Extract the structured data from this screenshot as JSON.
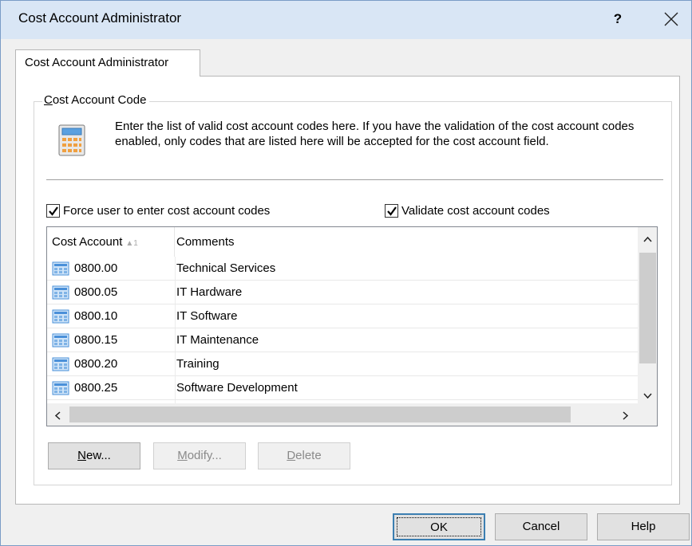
{
  "window": {
    "title": "Cost Account Administrator",
    "help_label": "?",
    "close_label": "✕"
  },
  "tab": {
    "label": "Cost Account Administrator"
  },
  "group": {
    "legend_access": "C",
    "legend_rest": "ost Account Code",
    "description": "Enter the list of valid cost account codes here. If you have the validation of the cost account codes enabled, only codes that are listed here will be accepted for the cost account field."
  },
  "checkboxes": {
    "force": {
      "label": "Force user to enter cost account codes",
      "checked": true
    },
    "validate": {
      "label": "Validate cost account codes",
      "checked": true
    }
  },
  "list": {
    "columns": [
      {
        "label": "Cost Account",
        "sort": "1"
      },
      {
        "label": "Comments"
      }
    ],
    "rows": [
      {
        "code": "0800.00",
        "comment": "Technical Services"
      },
      {
        "code": "0800.05",
        "comment": "IT Hardware"
      },
      {
        "code": "0800.10",
        "comment": "IT Software"
      },
      {
        "code": "0800.15",
        "comment": "IT Maintenance"
      },
      {
        "code": "0800.20",
        "comment": "Training"
      },
      {
        "code": "0800.25",
        "comment": "Software Development"
      }
    ]
  },
  "actions": {
    "new_access": "N",
    "new_rest": "ew...",
    "modify_access": "M",
    "modify_rest": "odify...",
    "delete_access": "D",
    "delete_rest": "elete"
  },
  "footer": {
    "ok": "OK",
    "cancel": "Cancel",
    "help": "Help"
  },
  "colors": {
    "titlebar": "#d9e6f5",
    "default_border": "#3c7fb1",
    "row_icon": "#4a90d9"
  }
}
